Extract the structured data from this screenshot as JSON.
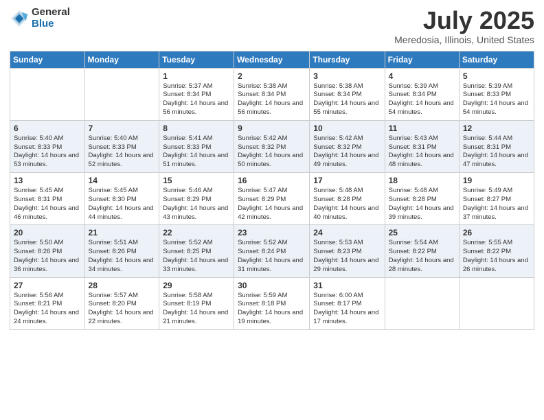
{
  "logo": {
    "general": "General",
    "blue": "Blue"
  },
  "title": "July 2025",
  "subtitle": "Meredosia, Illinois, United States",
  "weekdays": [
    "Sunday",
    "Monday",
    "Tuesday",
    "Wednesday",
    "Thursday",
    "Friday",
    "Saturday"
  ],
  "weeks": [
    [
      {
        "day": "",
        "sunrise": "",
        "sunset": "",
        "daylight": ""
      },
      {
        "day": "",
        "sunrise": "",
        "sunset": "",
        "daylight": ""
      },
      {
        "day": "1",
        "sunrise": "Sunrise: 5:37 AM",
        "sunset": "Sunset: 8:34 PM",
        "daylight": "Daylight: 14 hours and 56 minutes."
      },
      {
        "day": "2",
        "sunrise": "Sunrise: 5:38 AM",
        "sunset": "Sunset: 8:34 PM",
        "daylight": "Daylight: 14 hours and 56 minutes."
      },
      {
        "day": "3",
        "sunrise": "Sunrise: 5:38 AM",
        "sunset": "Sunset: 8:34 PM",
        "daylight": "Daylight: 14 hours and 55 minutes."
      },
      {
        "day": "4",
        "sunrise": "Sunrise: 5:39 AM",
        "sunset": "Sunset: 8:34 PM",
        "daylight": "Daylight: 14 hours and 54 minutes."
      },
      {
        "day": "5",
        "sunrise": "Sunrise: 5:39 AM",
        "sunset": "Sunset: 8:33 PM",
        "daylight": "Daylight: 14 hours and 54 minutes."
      }
    ],
    [
      {
        "day": "6",
        "sunrise": "Sunrise: 5:40 AM",
        "sunset": "Sunset: 8:33 PM",
        "daylight": "Daylight: 14 hours and 53 minutes."
      },
      {
        "day": "7",
        "sunrise": "Sunrise: 5:40 AM",
        "sunset": "Sunset: 8:33 PM",
        "daylight": "Daylight: 14 hours and 52 minutes."
      },
      {
        "day": "8",
        "sunrise": "Sunrise: 5:41 AM",
        "sunset": "Sunset: 8:33 PM",
        "daylight": "Daylight: 14 hours and 51 minutes."
      },
      {
        "day": "9",
        "sunrise": "Sunrise: 5:42 AM",
        "sunset": "Sunset: 8:32 PM",
        "daylight": "Daylight: 14 hours and 50 minutes."
      },
      {
        "day": "10",
        "sunrise": "Sunrise: 5:42 AM",
        "sunset": "Sunset: 8:32 PM",
        "daylight": "Daylight: 14 hours and 49 minutes."
      },
      {
        "day": "11",
        "sunrise": "Sunrise: 5:43 AM",
        "sunset": "Sunset: 8:31 PM",
        "daylight": "Daylight: 14 hours and 48 minutes."
      },
      {
        "day": "12",
        "sunrise": "Sunrise: 5:44 AM",
        "sunset": "Sunset: 8:31 PM",
        "daylight": "Daylight: 14 hours and 47 minutes."
      }
    ],
    [
      {
        "day": "13",
        "sunrise": "Sunrise: 5:45 AM",
        "sunset": "Sunset: 8:31 PM",
        "daylight": "Daylight: 14 hours and 46 minutes."
      },
      {
        "day": "14",
        "sunrise": "Sunrise: 5:45 AM",
        "sunset": "Sunset: 8:30 PM",
        "daylight": "Daylight: 14 hours and 44 minutes."
      },
      {
        "day": "15",
        "sunrise": "Sunrise: 5:46 AM",
        "sunset": "Sunset: 8:29 PM",
        "daylight": "Daylight: 14 hours and 43 minutes."
      },
      {
        "day": "16",
        "sunrise": "Sunrise: 5:47 AM",
        "sunset": "Sunset: 8:29 PM",
        "daylight": "Daylight: 14 hours and 42 minutes."
      },
      {
        "day": "17",
        "sunrise": "Sunrise: 5:48 AM",
        "sunset": "Sunset: 8:28 PM",
        "daylight": "Daylight: 14 hours and 40 minutes."
      },
      {
        "day": "18",
        "sunrise": "Sunrise: 5:48 AM",
        "sunset": "Sunset: 8:28 PM",
        "daylight": "Daylight: 14 hours and 39 minutes."
      },
      {
        "day": "19",
        "sunrise": "Sunrise: 5:49 AM",
        "sunset": "Sunset: 8:27 PM",
        "daylight": "Daylight: 14 hours and 37 minutes."
      }
    ],
    [
      {
        "day": "20",
        "sunrise": "Sunrise: 5:50 AM",
        "sunset": "Sunset: 8:26 PM",
        "daylight": "Daylight: 14 hours and 36 minutes."
      },
      {
        "day": "21",
        "sunrise": "Sunrise: 5:51 AM",
        "sunset": "Sunset: 8:26 PM",
        "daylight": "Daylight: 14 hours and 34 minutes."
      },
      {
        "day": "22",
        "sunrise": "Sunrise: 5:52 AM",
        "sunset": "Sunset: 8:25 PM",
        "daylight": "Daylight: 14 hours and 33 minutes."
      },
      {
        "day": "23",
        "sunrise": "Sunrise: 5:52 AM",
        "sunset": "Sunset: 8:24 PM",
        "daylight": "Daylight: 14 hours and 31 minutes."
      },
      {
        "day": "24",
        "sunrise": "Sunrise: 5:53 AM",
        "sunset": "Sunset: 8:23 PM",
        "daylight": "Daylight: 14 hours and 29 minutes."
      },
      {
        "day": "25",
        "sunrise": "Sunrise: 5:54 AM",
        "sunset": "Sunset: 8:22 PM",
        "daylight": "Daylight: 14 hours and 28 minutes."
      },
      {
        "day": "26",
        "sunrise": "Sunrise: 5:55 AM",
        "sunset": "Sunset: 8:22 PM",
        "daylight": "Daylight: 14 hours and 26 minutes."
      }
    ],
    [
      {
        "day": "27",
        "sunrise": "Sunrise: 5:56 AM",
        "sunset": "Sunset: 8:21 PM",
        "daylight": "Daylight: 14 hours and 24 minutes."
      },
      {
        "day": "28",
        "sunrise": "Sunrise: 5:57 AM",
        "sunset": "Sunset: 8:20 PM",
        "daylight": "Daylight: 14 hours and 22 minutes."
      },
      {
        "day": "29",
        "sunrise": "Sunrise: 5:58 AM",
        "sunset": "Sunset: 8:19 PM",
        "daylight": "Daylight: 14 hours and 21 minutes."
      },
      {
        "day": "30",
        "sunrise": "Sunrise: 5:59 AM",
        "sunset": "Sunset: 8:18 PM",
        "daylight": "Daylight: 14 hours and 19 minutes."
      },
      {
        "day": "31",
        "sunrise": "Sunrise: 6:00 AM",
        "sunset": "Sunset: 8:17 PM",
        "daylight": "Daylight: 14 hours and 17 minutes."
      },
      {
        "day": "",
        "sunrise": "",
        "sunset": "",
        "daylight": ""
      },
      {
        "day": "",
        "sunrise": "",
        "sunset": "",
        "daylight": ""
      }
    ]
  ]
}
